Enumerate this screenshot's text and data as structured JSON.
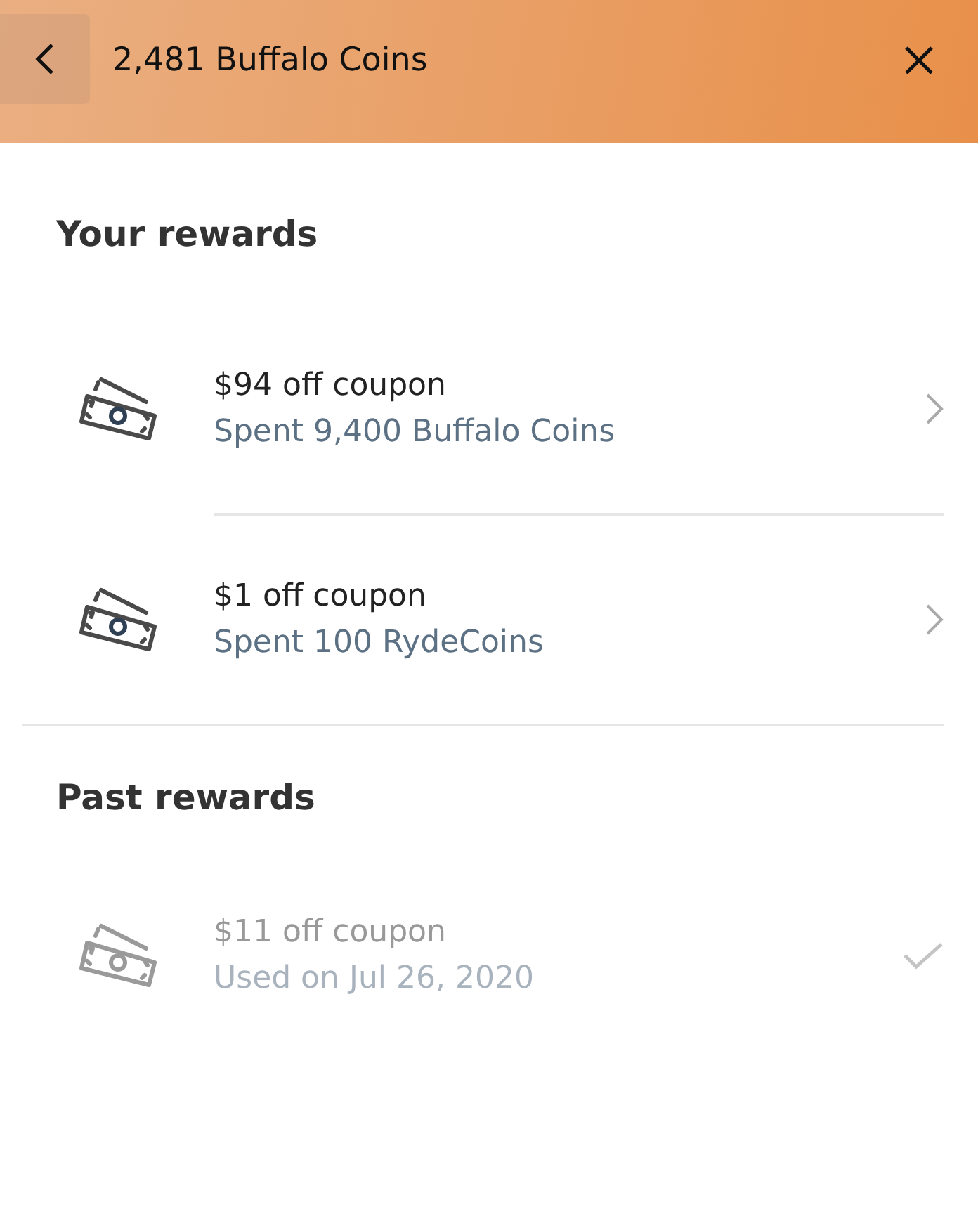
{
  "header": {
    "title": "2,481 Buffalo Coins"
  },
  "sections": [
    {
      "title": "Your rewards",
      "rewards": [
        {
          "title": "$94 off coupon",
          "subtitle": "Spent 9,400 Buffalo Coins",
          "used": false
        },
        {
          "title": "$1 off coupon",
          "subtitle": "Spent 100 RydeCoins",
          "used": false
        }
      ]
    },
    {
      "title": "Past rewards",
      "rewards": [
        {
          "title": "$11 off coupon",
          "subtitle": "Used on Jul 26, 2020",
          "used": true
        }
      ]
    }
  ]
}
